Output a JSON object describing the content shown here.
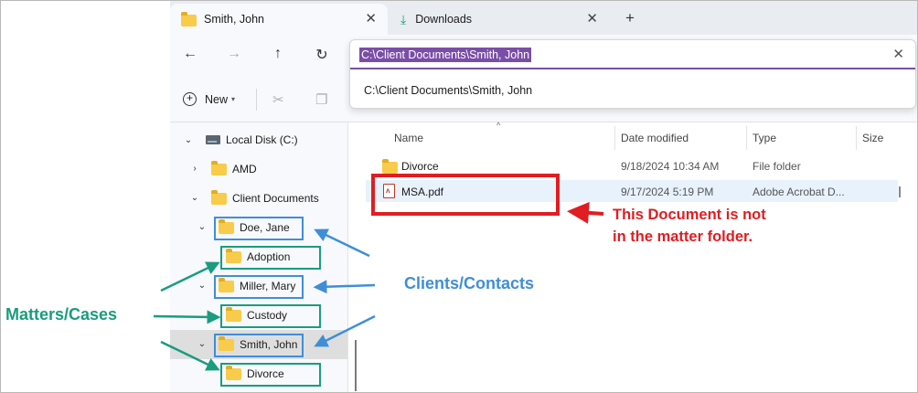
{
  "tabs": [
    {
      "label": "Smith, John",
      "icon": "folder-icon",
      "active": true
    },
    {
      "label": "Downloads",
      "icon": "download-icon",
      "active": false
    }
  ],
  "address_bar": {
    "value": "C:\\Client Documents\\Smith, John",
    "suggestion": "C:\\Client Documents\\Smith, John",
    "accent": "#7a4ea6"
  },
  "toolbar": {
    "new_label": "New"
  },
  "sidebar": {
    "items": [
      {
        "label": "Local Disk (C:)",
        "icon": "drive-icon",
        "expanded": true
      },
      {
        "label": "AMD",
        "icon": "folder-icon",
        "expanded": false
      },
      {
        "label": "Client Documents",
        "icon": "folder-icon",
        "expanded": true
      },
      {
        "label": "Doe, Jane",
        "icon": "folder-icon",
        "expanded": true
      },
      {
        "label": "Adoption",
        "icon": "folder-icon"
      },
      {
        "label": "Miller, Mary",
        "icon": "folder-icon",
        "expanded": true
      },
      {
        "label": "Custody",
        "icon": "folder-icon"
      },
      {
        "label": "Smith, John",
        "icon": "folder-icon",
        "expanded": true,
        "selected": true
      },
      {
        "label": "Divorce",
        "icon": "folder-icon"
      }
    ]
  },
  "file_list": {
    "columns": [
      "Name",
      "Date modified",
      "Type",
      "Size"
    ],
    "rows": [
      {
        "name": "Divorce",
        "date": "9/18/2024 10:34 AM",
        "type": "File folder",
        "size": "",
        "icon": "folder-icon"
      },
      {
        "name": "MSA.pdf",
        "date": "9/17/2024 5:19 PM",
        "type": "Adobe Acrobat D...",
        "size": "",
        "icon": "pdf-icon"
      }
    ]
  },
  "annotations": {
    "red_line1": "This Document is not",
    "red_line2": "in the matter folder.",
    "clients": "Clients/Contacts",
    "matters": "Matters/Cases",
    "colors": {
      "red": "#e01d22",
      "blue": "#3f8ed8",
      "green": "#1a9c7e"
    }
  }
}
